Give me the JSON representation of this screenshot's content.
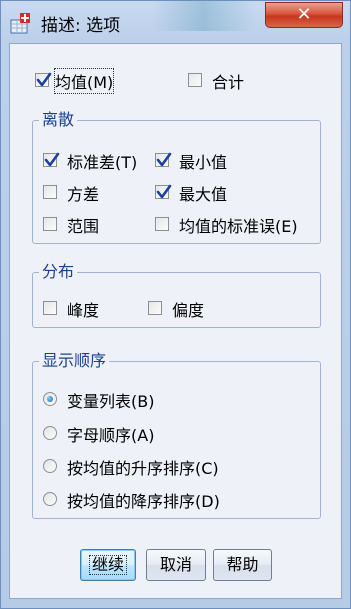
{
  "window": {
    "title": "描述: 选项",
    "close_label": "✕"
  },
  "top_options": {
    "mean": {
      "label": "均值(M)",
      "checked": true
    },
    "sum": {
      "label": "合计",
      "checked": false
    }
  },
  "dispersion": {
    "title": "离散",
    "items": [
      {
        "label": "标准差(T)",
        "checked": true
      },
      {
        "label": "最小值",
        "checked": true
      },
      {
        "label": "方差",
        "checked": false
      },
      {
        "label": "最大值",
        "checked": true
      },
      {
        "label": "范围",
        "checked": false
      },
      {
        "label": "均值的标准误(E)",
        "checked": false
      }
    ]
  },
  "distribution": {
    "title": "分布",
    "items": [
      {
        "label": "峰度",
        "checked": false
      },
      {
        "label": "偏度",
        "checked": false
      }
    ]
  },
  "display_order": {
    "title": "显示顺序",
    "selected_index": 0,
    "items": [
      {
        "label": "变量列表(B)"
      },
      {
        "label": "字母顺序(A)"
      },
      {
        "label": "按均值的升序排序(C)"
      },
      {
        "label": "按均值的降序排序(D)"
      }
    ]
  },
  "buttons": {
    "continue_label": "继续",
    "cancel_label": "取消",
    "help_label": "帮助"
  },
  "colors": {
    "group_title": "#1b3f8f",
    "close_button": "#c7351d",
    "default_button_border": "#3c7fb1"
  }
}
